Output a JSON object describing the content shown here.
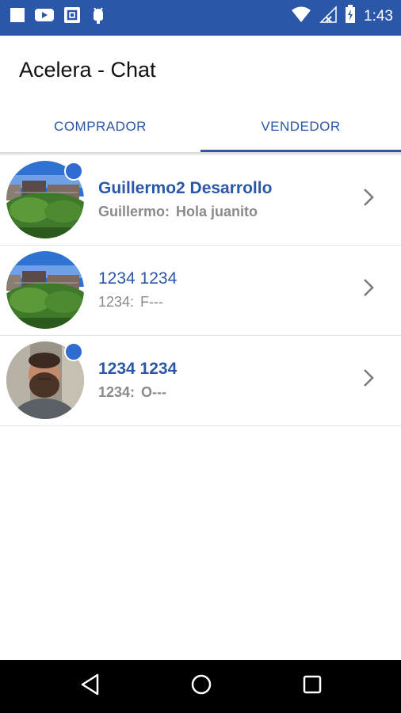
{
  "status_bar": {
    "time": "1:43",
    "left_icons": [
      "square-notification-icon",
      "youtube-icon",
      "app-notification-icon",
      "android-debug-icon"
    ],
    "right_icons": [
      "wifi-icon",
      "signal-icon",
      "battery-icon"
    ],
    "bg_color": "#2a57a8"
  },
  "app_bar": {
    "title": "Acelera - Chat"
  },
  "tabs": [
    {
      "label": "COMPRADOR",
      "selected": false
    },
    {
      "label": "VENDEDOR",
      "selected": true
    }
  ],
  "accent_color": "#2a57a8",
  "chats": [
    {
      "name": "Guillermo2 Desarrollo",
      "sender": "Guillermo:",
      "message": "Hola juanito",
      "unread": true,
      "avatar": "street-photo"
    },
    {
      "name": "1234 1234",
      "sender": "1234:",
      "message": "F---",
      "unread": false,
      "avatar": "street-photo"
    },
    {
      "name": "1234 1234",
      "sender": "1234:",
      "message": "O---",
      "unread": true,
      "avatar": "person-photo"
    }
  ],
  "nav_bar": {
    "buttons": [
      "back-icon",
      "home-icon",
      "recents-icon"
    ]
  }
}
